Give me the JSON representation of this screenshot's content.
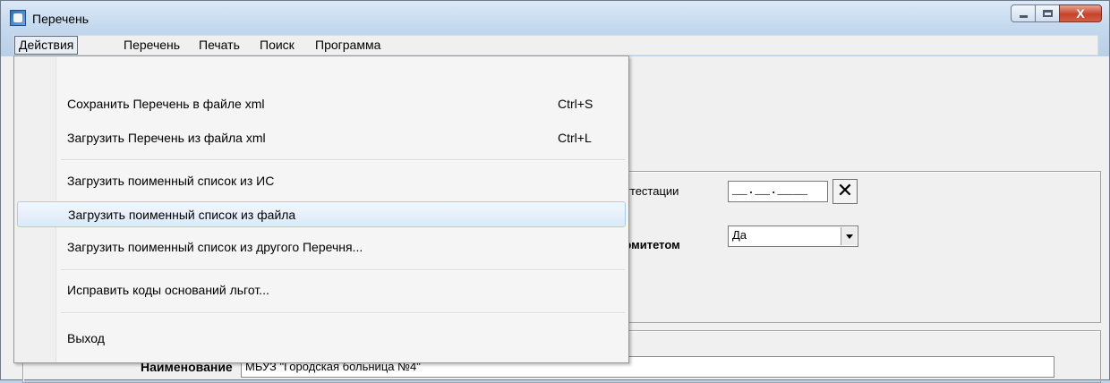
{
  "window": {
    "title": "Перечень",
    "close_label": "X"
  },
  "menubar": {
    "items": [
      "Действия",
      "Перечень",
      "Печать",
      "Поиск",
      "Программа"
    ]
  },
  "dropdown": {
    "items": [
      {
        "label": "Сохранить Перечень в файле xml",
        "shortcut": "Ctrl+S"
      },
      {
        "label": "Загрузить Перечень из файла xml",
        "shortcut": "Ctrl+L"
      },
      {
        "label": "Загрузить поименный список из ИС",
        "shortcut": ""
      },
      {
        "label": "Загрузить поименный список из файла",
        "shortcut": ""
      },
      {
        "label": "Загрузить поименный список из другого Перечня...",
        "shortcut": ""
      },
      {
        "label": "Исправить коды оснований льгот...",
        "shortcut": ""
      },
      {
        "label": "Выход",
        "shortcut": ""
      }
    ]
  },
  "form": {
    "attestation_label": "аттестации",
    "date_value": "__.__.____",
    "clear_symbol": "✕",
    "committee_label": "комитетом",
    "committee_value": "Да",
    "name_label": "Наименование",
    "name_value": "МБУЗ \"Городская больница №4\""
  }
}
